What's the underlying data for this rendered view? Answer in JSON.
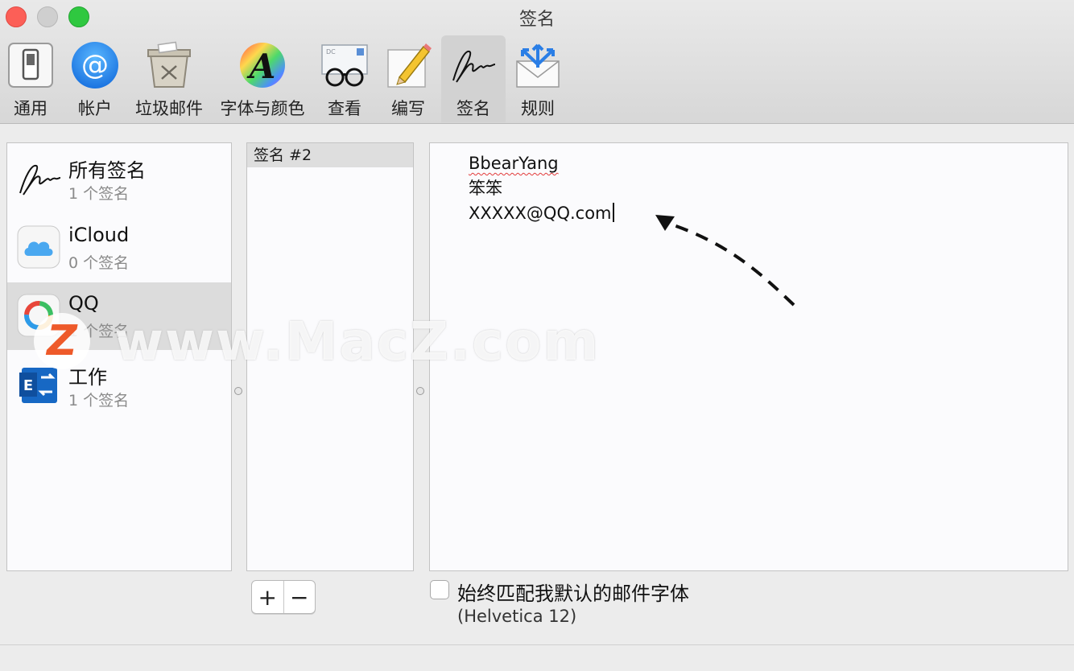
{
  "window": {
    "title": "签名"
  },
  "toolbar": {
    "items": [
      {
        "label": "通用",
        "icon": "general-switch-icon"
      },
      {
        "label": "帐户",
        "icon": "at-sign-icon"
      },
      {
        "label": "垃圾邮件",
        "icon": "junk-bin-icon"
      },
      {
        "label": "字体与颜色",
        "icon": "font-color-icon"
      },
      {
        "label": "查看",
        "icon": "glasses-icon"
      },
      {
        "label": "编写",
        "icon": "pencil-icon"
      },
      {
        "label": "签名",
        "icon": "signature-icon",
        "active": true
      },
      {
        "label": "规则",
        "icon": "rules-envelope-icon"
      }
    ]
  },
  "accounts": [
    {
      "name": "所有签名",
      "count": "1 个签名",
      "icon": "signature-icon"
    },
    {
      "name": "iCloud",
      "count": "0 个签名",
      "icon": "icloud-icon"
    },
    {
      "name": "QQ",
      "count": "1 个签名",
      "icon": "qq-mail-icon",
      "selected": true
    },
    {
      "name": "工作",
      "count": "1 个签名",
      "icon": "exchange-icon"
    }
  ],
  "signatures": [
    {
      "name": "签名 #2",
      "selected": true
    }
  ],
  "editor": {
    "lines": [
      "BbearYang",
      "笨笨",
      "XXXXX@QQ.com"
    ]
  },
  "bottom": {
    "add_label": "+",
    "remove_label": "−",
    "match_font_label": "始终匹配我默认的邮件字体",
    "match_font_checked": false,
    "font_note": "(Helvetica 12)"
  },
  "watermark": {
    "logo": "Z",
    "text": "www.MacZ.com"
  }
}
